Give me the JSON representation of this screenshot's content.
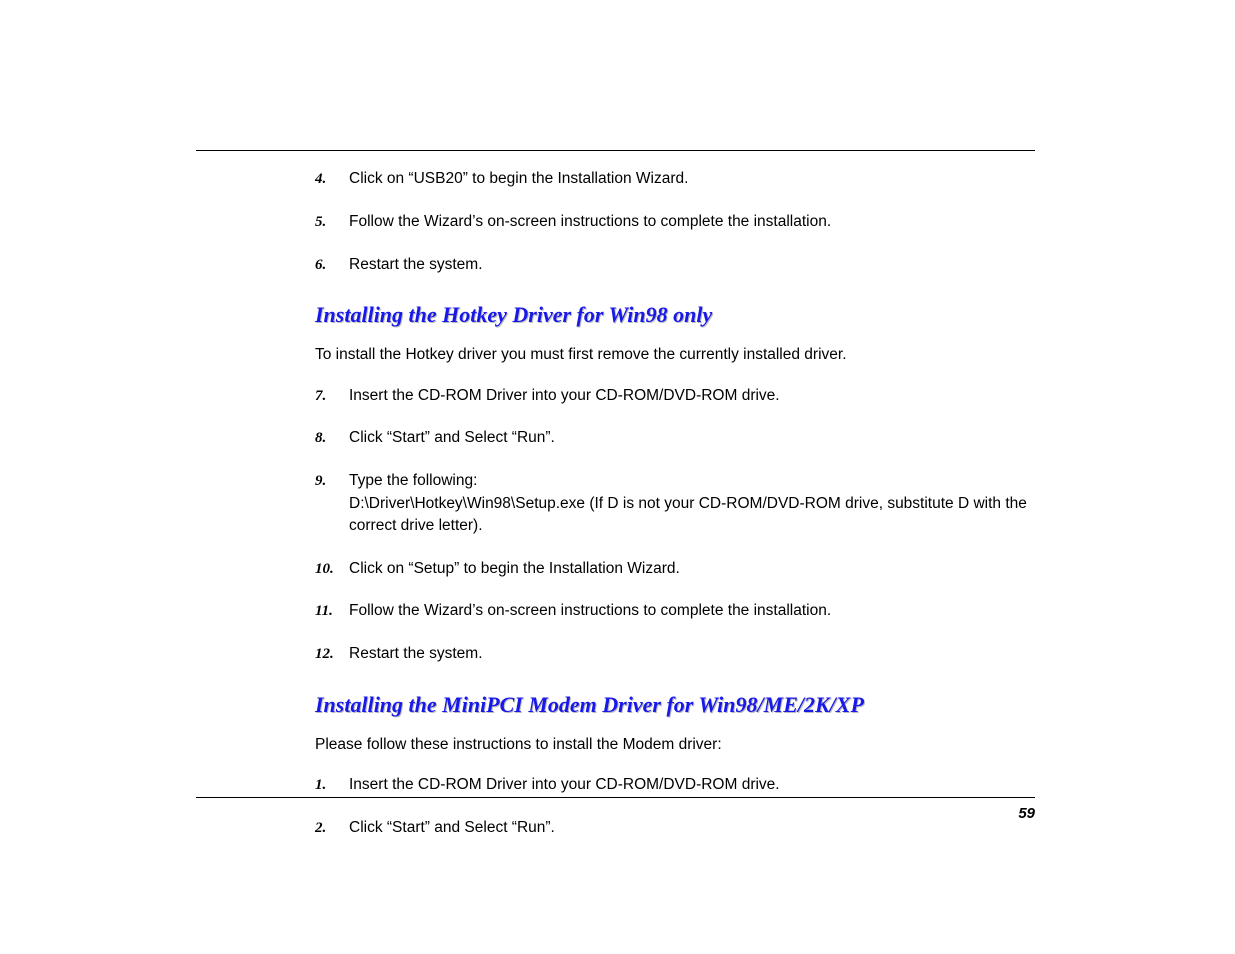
{
  "top_list": [
    {
      "num": "4.",
      "text": "Click on “USB20” to begin the Installation Wizard."
    },
    {
      "num": "5.",
      "text": "Follow the Wizard’s on-screen instructions to complete the installation."
    },
    {
      "num": "6.",
      "text": "Restart the system."
    }
  ],
  "heading1": "Installing the Hotkey Driver for Win98 only",
  "para1": "To install the Hotkey driver you must first remove the currently installed driver.",
  "list2": [
    {
      "num": "7.",
      "text": "Insert the CD-ROM Driver into your CD-ROM/DVD-ROM drive."
    },
    {
      "num": "8.",
      "text": "Click “Start” and Select “Run”."
    },
    {
      "num": "9.",
      "text": "Type the following:\nD:\\Driver\\Hotkey\\Win98\\Setup.exe (If D is not your CD-ROM/DVD-ROM drive, substitute D with the correct drive letter)."
    },
    {
      "num": "10.",
      "text": "Click on “Setup” to begin the Installation Wizard."
    },
    {
      "num": "11.",
      "text": "Follow the Wizard’s on-screen instructions to complete the installation."
    },
    {
      "num": "12.",
      "text": "Restart the system."
    }
  ],
  "heading2": "Installing the MiniPCI Modem Driver for Win98/ME/2K/XP",
  "para2": "Please follow these instructions to install the Modem driver:",
  "list3": [
    {
      "num": "1.",
      "text": "Insert the CD-ROM Driver into your CD-ROM/DVD-ROM drive."
    },
    {
      "num": "2.",
      "text": "Click “Start” and Select “Run”."
    }
  ],
  "page_number": "59"
}
